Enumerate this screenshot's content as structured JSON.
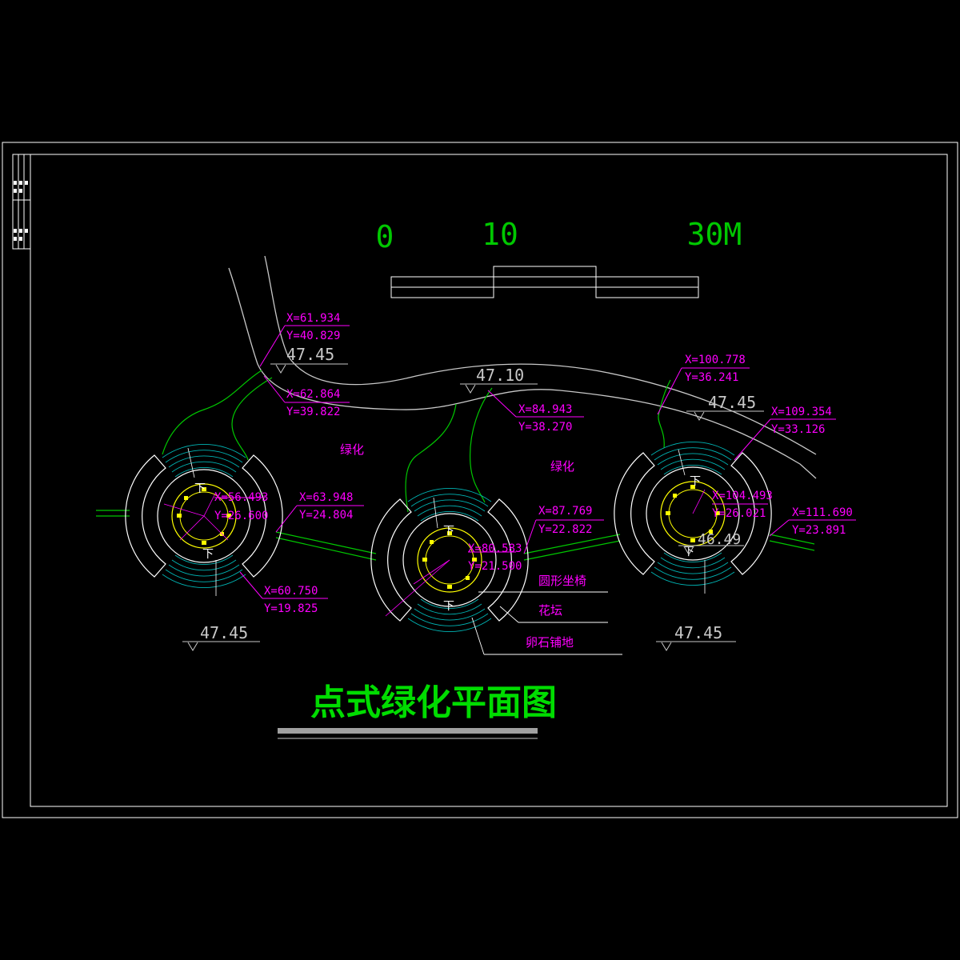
{
  "drawing": {
    "title": "点式绿化平面图",
    "colors": {
      "background": "#000000",
      "frame": "#ffffff",
      "path": "#c8c8c8",
      "green": "#00c800",
      "magenta": "#ff00ff",
      "cyan": "#00b4b4",
      "yellow": "#ffff00",
      "red": "#ff0000"
    }
  },
  "scale_bar": {
    "labels": [
      "0",
      "10",
      "30M"
    ]
  },
  "elevations": [
    "47.45",
    "47.10",
    "47.45",
    "47.45",
    "47.45",
    "46.49"
  ],
  "coordinates": [
    {
      "x": "X=61.934",
      "y": "Y=40.829"
    },
    {
      "x": "X=62.864",
      "y": "Y=39.822"
    },
    {
      "x": "X=100.778",
      "y": "Y=36.241"
    },
    {
      "x": "X=84.943",
      "y": "Y=38.270"
    },
    {
      "x": "X=109.354",
      "y": "Y=33.126"
    },
    {
      "x": "X=56.493",
      "y": "Y=26.600"
    },
    {
      "x": "X=63.948",
      "y": "Y=24.804"
    },
    {
      "x": "X=87.769",
      "y": "Y=22.822"
    },
    {
      "x": "X=80.583",
      "y": "Y=21.500"
    },
    {
      "x": "X=104.493",
      "y": "Y=26.021"
    },
    {
      "x": "X=111.690",
      "y": "Y=23.891"
    },
    {
      "x": "X=60.750",
      "y": "Y=19.825"
    }
  ],
  "labels": {
    "greenery": "绿化",
    "down": "下",
    "round_bench": "圆形坐椅",
    "flower_bed": "花坛",
    "pebble_paving": "卵石铺地"
  }
}
